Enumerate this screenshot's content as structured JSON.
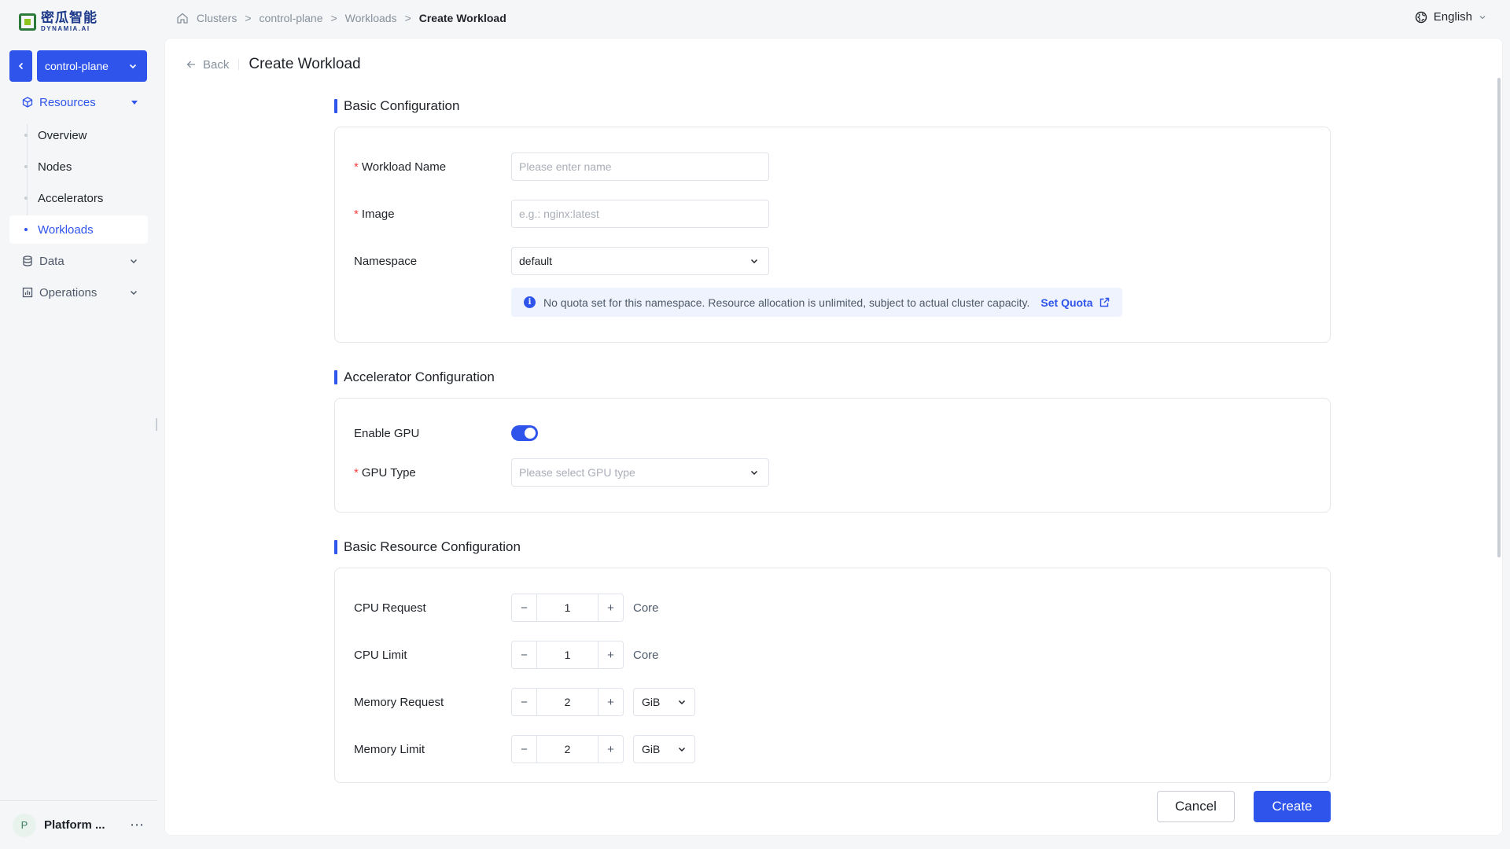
{
  "brand": {
    "cn": "密瓜智能",
    "en": "DYNAMIA.AI"
  },
  "cluster_selector": {
    "value": "control-plane"
  },
  "sidebar": {
    "groups": [
      {
        "label": "Resources",
        "items": [
          "Overview",
          "Nodes",
          "Accelerators",
          "Workloads"
        ],
        "active_item": "Workloads"
      },
      {
        "label": "Data"
      },
      {
        "label": "Operations"
      }
    ],
    "user": {
      "initial": "P",
      "name": "Platform ..."
    }
  },
  "breadcrumb": [
    "Clusters",
    "control-plane",
    "Workloads",
    "Create Workload"
  ],
  "breadcrumb_separator": ">",
  "language": "English",
  "page": {
    "back_label": "Back",
    "title": "Create Workload"
  },
  "basic_config": {
    "title": "Basic Configuration",
    "workload_name": {
      "label": "Workload Name",
      "value": "",
      "placeholder": "Please enter name"
    },
    "image": {
      "label": "Image",
      "value": "",
      "placeholder": "e.g.: nginx:latest"
    },
    "namespace": {
      "label": "Namespace",
      "value": "default"
    },
    "quota_notice": "No quota set for this namespace. Resource allocation is unlimited, subject to actual cluster capacity.",
    "set_quota_label": "Set Quota"
  },
  "accelerator_config": {
    "title": "Accelerator Configuration",
    "enable_gpu": {
      "label": "Enable GPU",
      "checked": true
    },
    "gpu_type": {
      "label": "GPU Type",
      "placeholder": "Please select GPU type"
    }
  },
  "resource_config": {
    "title": "Basic Resource Configuration",
    "cpu_request": {
      "label": "CPU Request",
      "value": "1",
      "unit": "Core"
    },
    "cpu_limit": {
      "label": "CPU Limit",
      "value": "1",
      "unit": "Core"
    },
    "memory_request": {
      "label": "Memory Request",
      "value": "2",
      "unit": "GiB"
    },
    "memory_limit": {
      "label": "Memory Limit",
      "value": "2",
      "unit": "GiB"
    }
  },
  "stepper_symbols": {
    "minus": "−",
    "plus": "+"
  },
  "required_mark": "*",
  "actions": {
    "cancel": "Cancel",
    "create": "Create"
  },
  "colors": {
    "primary": "#2f54eb",
    "required": "#f53f3f",
    "info_bg": "#eef3fd"
  }
}
